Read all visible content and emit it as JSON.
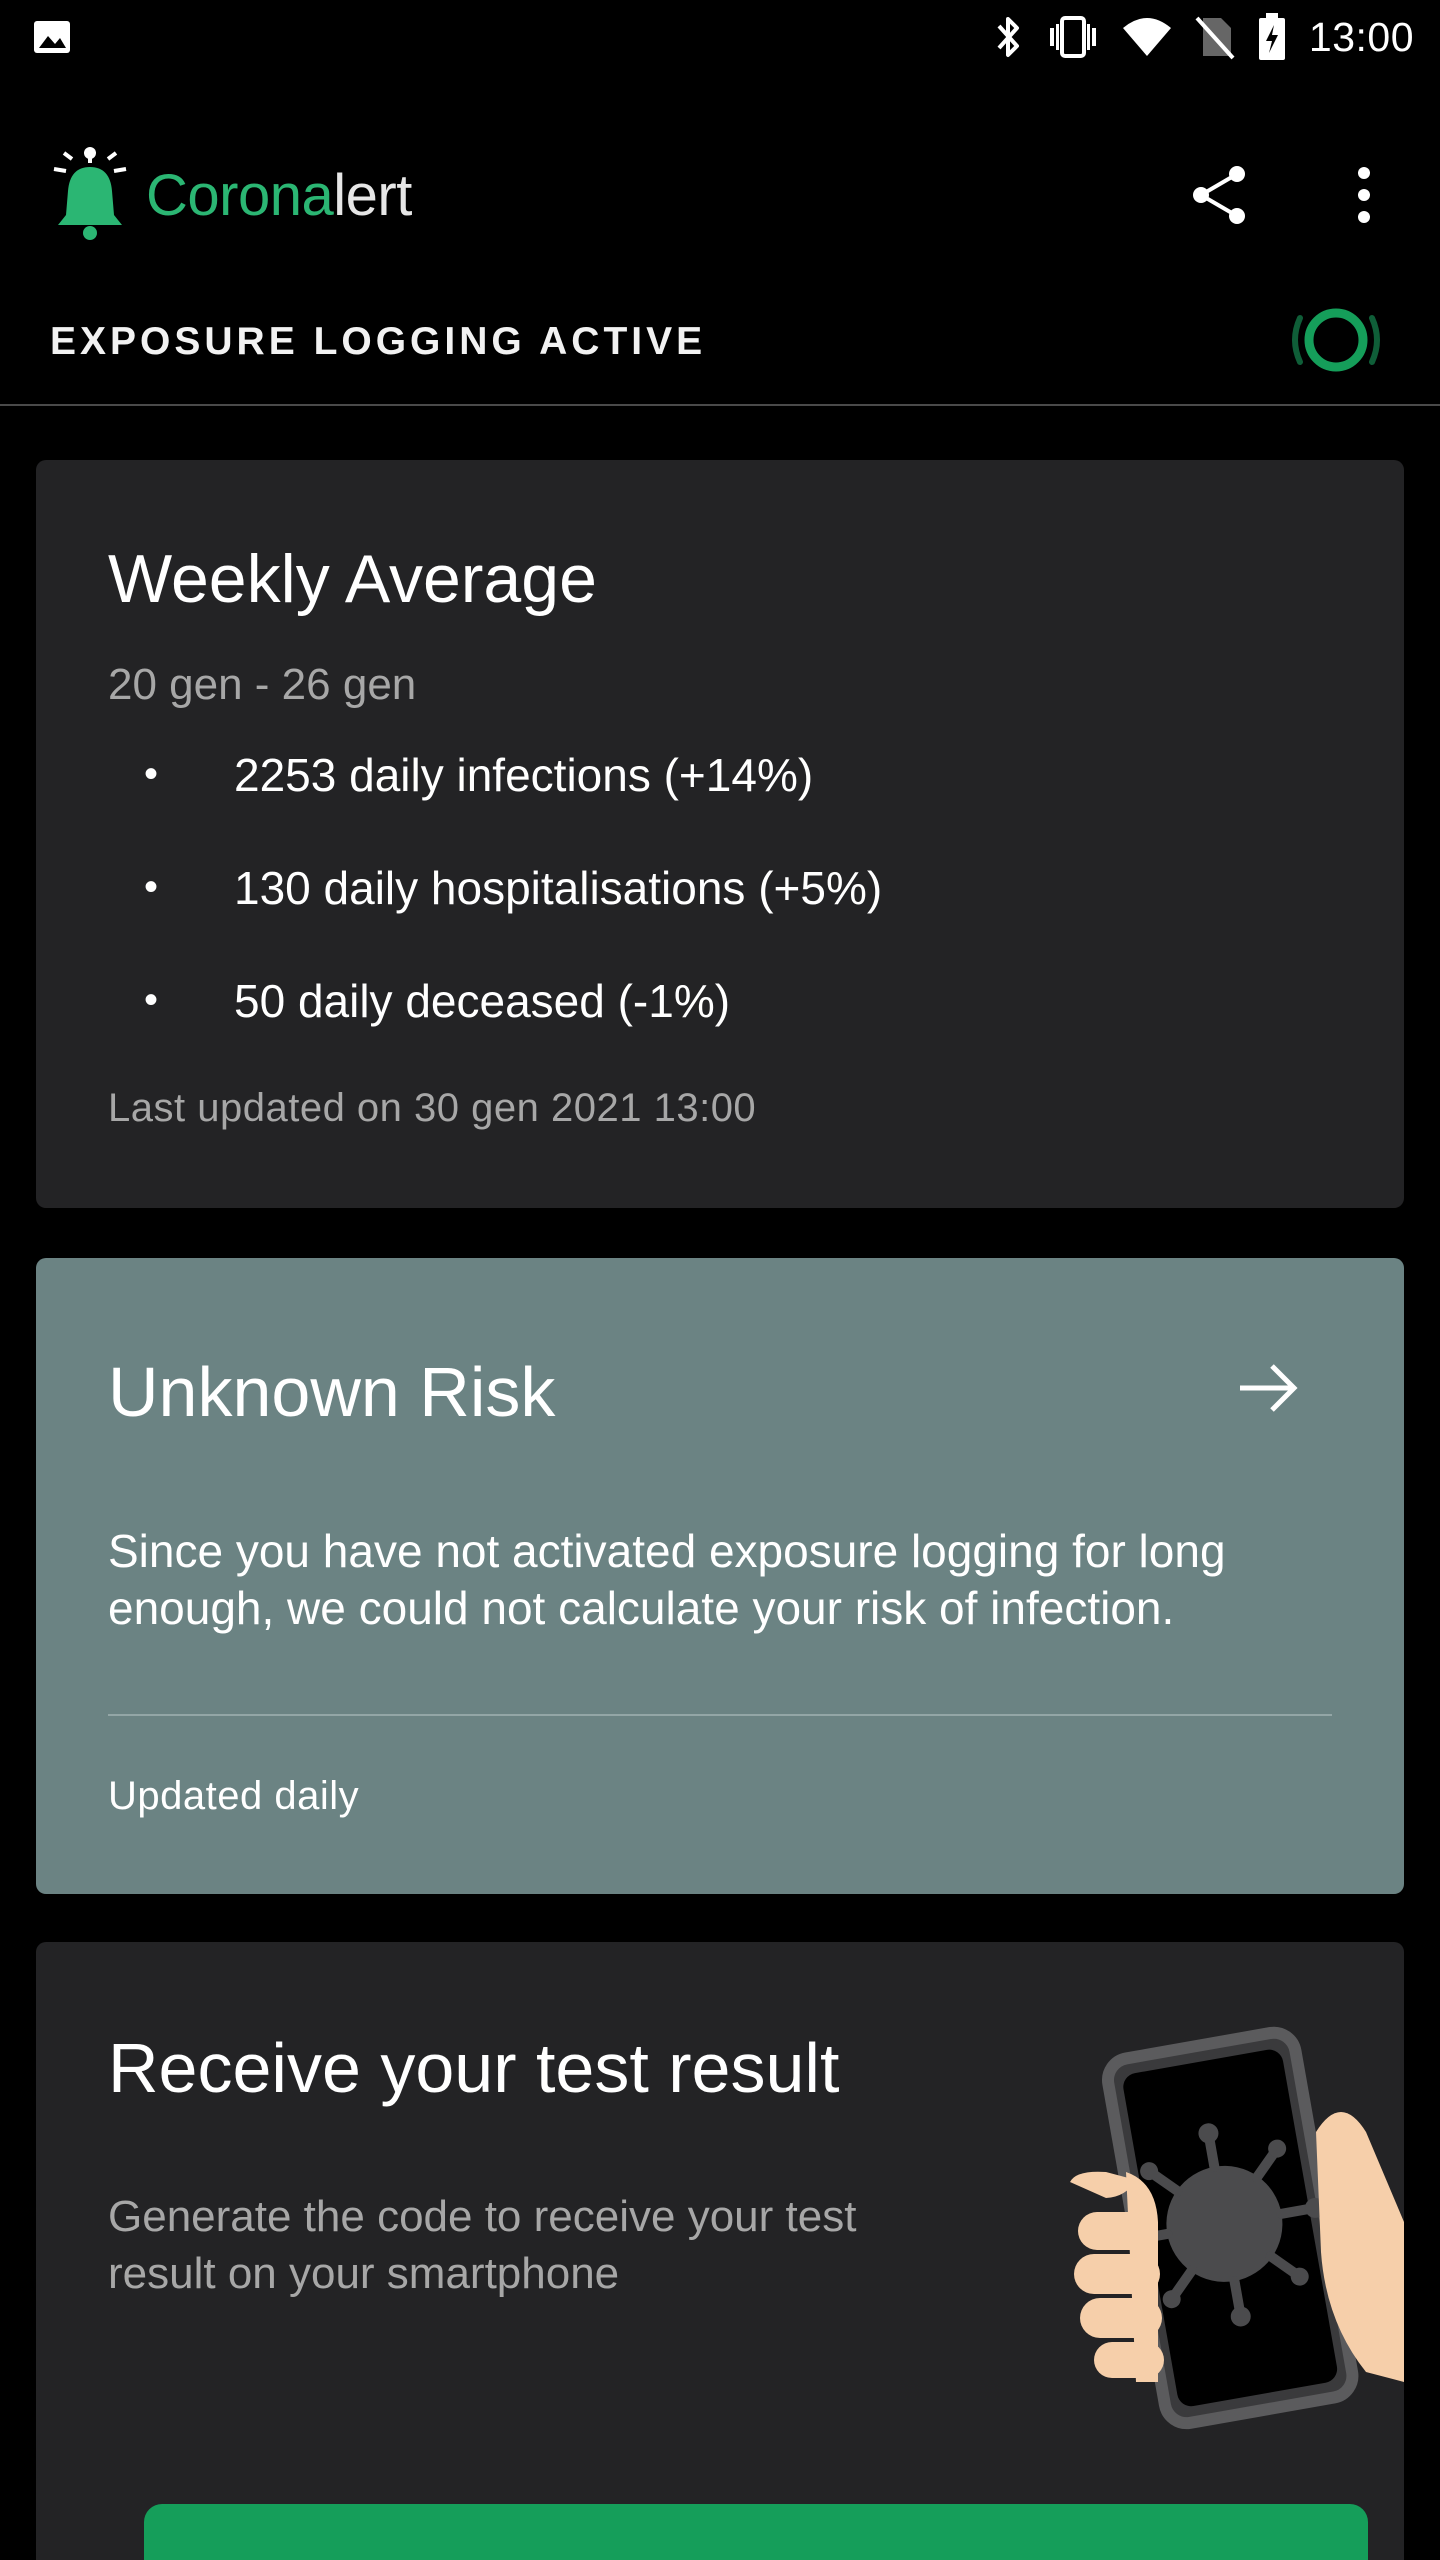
{
  "status_bar": {
    "time": "13:00",
    "icons": [
      "image-icon",
      "bluetooth-icon",
      "vibrate-icon",
      "wifi-icon",
      "no-sim-icon",
      "battery-charging-icon"
    ]
  },
  "app_bar": {
    "brand_part1": "Corona",
    "brand_part2": "lert",
    "share_icon": "share-icon",
    "menu_icon": "more-vert-icon"
  },
  "logging": {
    "label": "EXPOSURE LOGGING ACTIVE",
    "status_icon": "logging-active-ring-icon"
  },
  "weekly": {
    "title": "Weekly Average",
    "date_range": "20 gen - 26 gen",
    "bullets": [
      "2253 daily infections (+14%)",
      "130 daily hospitalisations (+5%)",
      "50 daily deceased (-1%)"
    ],
    "bullet_mark": "•",
    "updated": "Last updated on 30 gen 2021 13:00"
  },
  "risk": {
    "title": "Unknown Risk",
    "arrow_icon": "arrow-right-icon",
    "body": "Since you have not activated exposure logging for long enough, we could not calculate your risk of infection.",
    "updated": "Updated daily"
  },
  "test": {
    "title": "Receive your test result",
    "body": "Generate the code to receive your test result on your smartphone",
    "illustration": "hand-holding-phone-illustration"
  },
  "colors": {
    "accent_green": "#2bb673",
    "button_green": "#159e5a",
    "card_dark": "#232325",
    "card_risk": "#6b8383",
    "background": "#000000"
  }
}
